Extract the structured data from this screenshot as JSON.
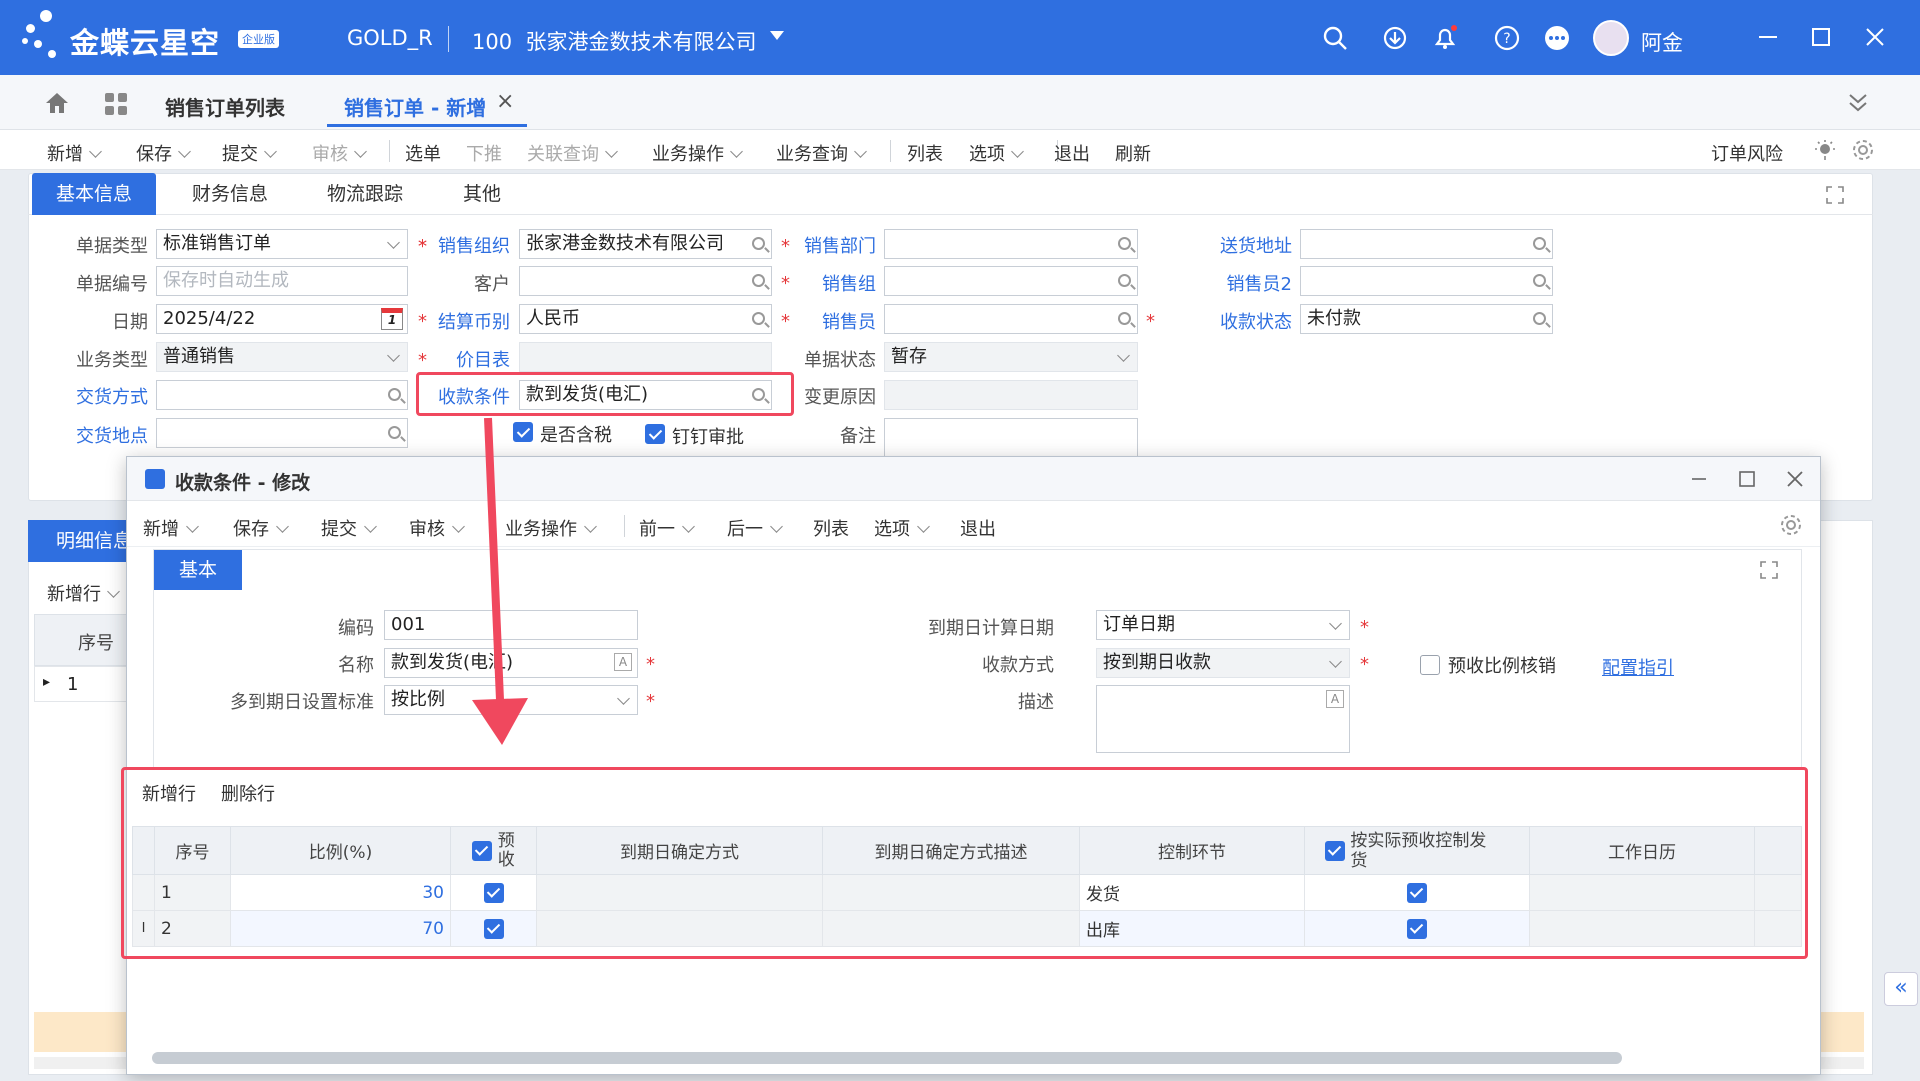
{
  "header": {
    "brand": "金蝶云星空",
    "edition": "企业版",
    "account": "GOLD_R",
    "org_code": "100",
    "org_name": "张家港金数技术有限公司",
    "user_name": "阿金",
    "accent_color": "#2f6fe0"
  },
  "tabs": [
    {
      "label": "销售订单列表"
    },
    {
      "label": "销售订单 - 新增"
    }
  ],
  "toolbar": {
    "items": [
      "新增",
      "保存",
      "提交",
      "审核",
      "选单",
      "下推",
      "关联查询",
      "业务操作",
      "业务查询",
      "列表",
      "选项",
      "退出",
      "刷新"
    ],
    "order_risk": "订单风险"
  },
  "form": {
    "subtabs": [
      "基本信息",
      "财务信息",
      "物流跟踪",
      "其他"
    ],
    "fields": {
      "doc_type": {
        "label": "单据类型",
        "value": "标准销售订单"
      },
      "doc_no": {
        "label": "单据编号",
        "placeholder": "保存时自动生成"
      },
      "date": {
        "label": "日期",
        "value": "2025/4/22",
        "cal_day": "1"
      },
      "biz_type": {
        "label": "业务类型",
        "value": "普通销售"
      },
      "delivery_method": {
        "label": "交货方式",
        "value": ""
      },
      "delivery_place": {
        "label": "交货地点",
        "value": ""
      },
      "sales_org": {
        "label": "销售组织",
        "value": "张家港金数技术有限公司"
      },
      "customer": {
        "label": "客户",
        "value": ""
      },
      "currency": {
        "label": "结算币别",
        "value": "人民币"
      },
      "price_list": {
        "label": "价目表",
        "value": ""
      },
      "payment_terms": {
        "label": "收款条件",
        "value": "款到发货(电汇)"
      },
      "sales_dept": {
        "label": "销售部门",
        "value": ""
      },
      "sales_group": {
        "label": "销售组",
        "value": ""
      },
      "salesperson": {
        "label": "销售员",
        "value": ""
      },
      "doc_status": {
        "label": "单据状态",
        "value": "暂存"
      },
      "change_reason": {
        "label": "变更原因",
        "value": ""
      },
      "remark": {
        "label": "备注",
        "value": ""
      },
      "ship_address": {
        "label": "送货地址",
        "value": ""
      },
      "salesperson2": {
        "label": "销售员2",
        "value": ""
      },
      "receipt_status": {
        "label": "收款状态",
        "value": "未付款"
      }
    },
    "tax_included": {
      "label": "是否含税",
      "checked": true
    },
    "dingtalk_approval": {
      "label": "钉钉审批",
      "checked": true
    }
  },
  "detail": {
    "tab": "明细信息",
    "add_row": "新增行",
    "col_seq": "序号",
    "row1": "1"
  },
  "dialog": {
    "title": "收款条件 - 修改",
    "toolbar": [
      "新增",
      "保存",
      "提交",
      "审核",
      "业务操作",
      "前一",
      "后一",
      "列表",
      "选项",
      "退出"
    ],
    "subtab": "基本",
    "code": {
      "label": "编码",
      "value": "001"
    },
    "name": {
      "label": "名称",
      "value": "款到发货(电汇)"
    },
    "multi_due": {
      "label": "多到期日设置标准",
      "value": "按比例"
    },
    "due_calc_date": {
      "label": "到期日计算日期",
      "value": "订单日期"
    },
    "receipt_method": {
      "label": "收款方式",
      "value": "按到期日收款"
    },
    "description": {
      "label": "描述",
      "value": ""
    },
    "prepay_ratio": {
      "label": "预收比例核销",
      "checked": false
    },
    "config_guide": "配置指引",
    "grid": {
      "add_row": "新增行",
      "delete_row": "删除行",
      "columns": [
        "序号",
        "比例(%)",
        "预收",
        "到期日确定方式",
        "到期日确定方式描述",
        "控制环节",
        "按实际预收控制发货",
        "工作日历"
      ],
      "rows": [
        {
          "seq": "1",
          "ratio": "30",
          "prepay": true,
          "due_method": "",
          "due_desc": "",
          "control": "发货",
          "actual_ctrl": true,
          "calendar": ""
        },
        {
          "seq": "2",
          "ratio": "70",
          "prepay": true,
          "due_method": "",
          "due_desc": "",
          "control": "出库",
          "actual_ctrl": true,
          "calendar": ""
        }
      ]
    }
  },
  "annotation_color": "#f0485e"
}
